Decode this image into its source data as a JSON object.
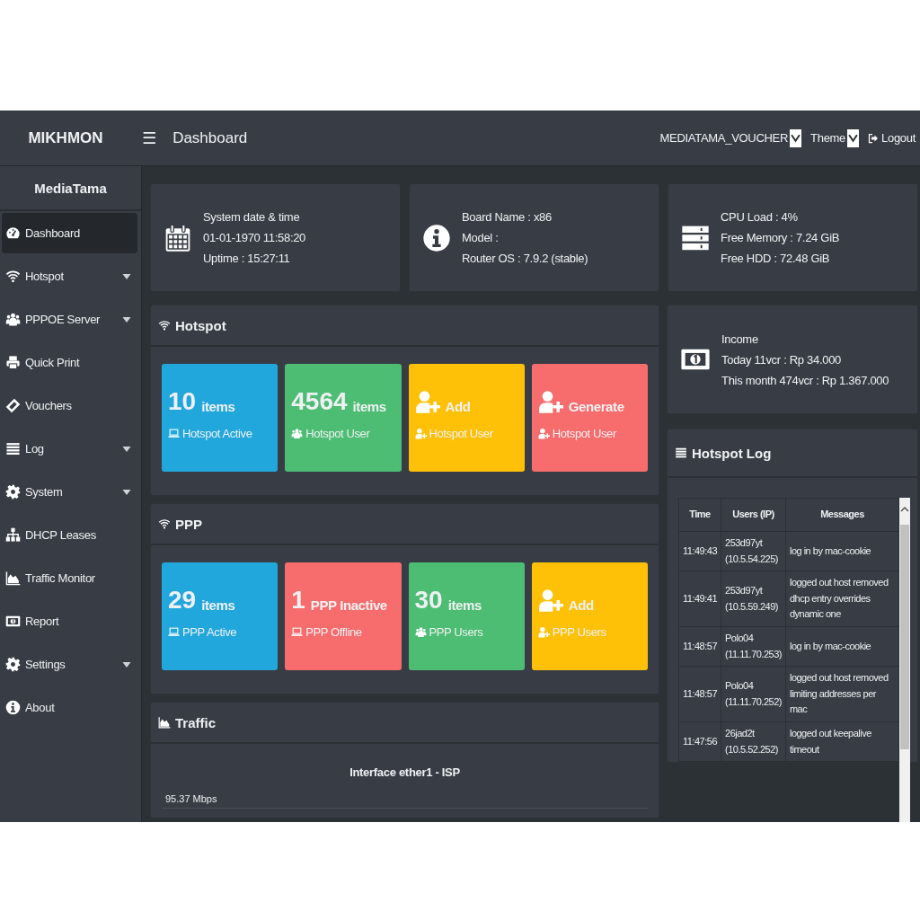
{
  "topbar": {
    "brand": "MIKHMON",
    "menu_icon": "☰",
    "page_title": "Dashboard",
    "session_select": "MEDIATAMA_VOUCHER",
    "theme_select": "Theme",
    "logout": "Logout"
  },
  "sidebar": {
    "title": "MediaTama",
    "items": [
      {
        "label": "Dashboard",
        "selected": true,
        "expandable": false
      },
      {
        "label": "Hotspot",
        "selected": false,
        "expandable": true
      },
      {
        "label": "PPPOE Server",
        "selected": false,
        "expandable": true
      },
      {
        "label": "Quick Print",
        "selected": false,
        "expandable": false
      },
      {
        "label": "Vouchers",
        "selected": false,
        "expandable": false
      },
      {
        "label": "Log",
        "selected": false,
        "expandable": true
      },
      {
        "label": "System",
        "selected": false,
        "expandable": true
      },
      {
        "label": "DHCP Leases",
        "selected": false,
        "expandable": false
      },
      {
        "label": "Traffic Monitor",
        "selected": false,
        "expandable": false
      },
      {
        "label": "Report",
        "selected": false,
        "expandable": false
      },
      {
        "label": "Settings",
        "selected": false,
        "expandable": true
      },
      {
        "label": "About",
        "selected": false,
        "expandable": false
      }
    ]
  },
  "info_cards": [
    {
      "lines": [
        "System date & time",
        "01-01-1970 11:58:20",
        "Uptime : 15:27:11"
      ]
    },
    {
      "lines": [
        "Board Name : x86",
        "Model :",
        "Router OS : 7.9.2 (stable)"
      ]
    },
    {
      "lines": [
        "CPU Load : 4%",
        "Free Memory : 7.24 GiB",
        "Free HDD : 72.48 GiB"
      ]
    }
  ],
  "hotspot": {
    "title": "Hotspot",
    "tiles": [
      {
        "kind": "count",
        "value": "10",
        "unit": "items",
        "label": "Hotspot Active",
        "color": "#22a7dc"
      },
      {
        "kind": "count",
        "value": "4564",
        "unit": "items",
        "label": "Hotspot User",
        "color": "#4dbd74"
      },
      {
        "kind": "action",
        "unit": "Add",
        "label": "Hotspot User",
        "color": "#ffc107"
      },
      {
        "kind": "action",
        "unit": "Generate",
        "label": "Hotspot User",
        "color": "#f76c6c"
      }
    ]
  },
  "ppp": {
    "title": "PPP",
    "tiles": [
      {
        "kind": "count",
        "value": "29",
        "unit": "items",
        "label": "PPP Active",
        "color": "#22a7dc"
      },
      {
        "kind": "count",
        "value": "1",
        "unit": "PPP Inactive",
        "label": "PPP Offline",
        "color": "#f76c6c"
      },
      {
        "kind": "count",
        "value": "30",
        "unit": "items",
        "label": "PPP Users",
        "color": "#4dbd74"
      },
      {
        "kind": "action",
        "unit": "Add",
        "label": "PPP Users",
        "color": "#ffc107"
      }
    ]
  },
  "traffic": {
    "title": "Traffic",
    "chart_title": "Interface ether1 - ISP",
    "axis_label": "95.37 Mbps"
  },
  "income": {
    "lines": [
      "Income",
      "Today 11vcr : Rp 34.000",
      "This month 474vcr : Rp 1.367.000"
    ]
  },
  "hotspot_log": {
    "title": "Hotspot Log",
    "columns": [
      "Time",
      "Users (IP)",
      "Messages"
    ],
    "rows": [
      {
        "time": "11:49:43",
        "user": "253d97yt (10.5.54.225)",
        "message": "log in by mac-cookie"
      },
      {
        "time": "11:49:41",
        "user": "253d97yt (10.5.59.249)",
        "message": "logged out host removed dhcp entry overrides dynamic one"
      },
      {
        "time": "11:48:57",
        "user": "Polo04 (11.11.70.253)",
        "message": "log in by mac-cookie"
      },
      {
        "time": "11:48:57",
        "user": "Polo04 (11.11.70.252)",
        "message": "logged out host removed limiting addresses per mac"
      },
      {
        "time": "11:47:56",
        "user": "26jad2t (10.5.52.252)",
        "message": "logged out keepalive timeout"
      }
    ]
  }
}
